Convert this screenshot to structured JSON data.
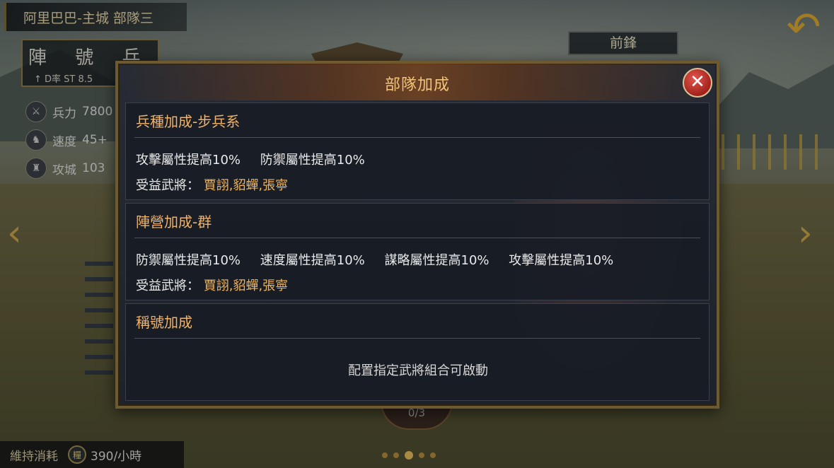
{
  "header": {
    "city_title": "阿里巴巴-主城 部隊三",
    "formation_badge": "陣 號 兵",
    "formation_sub": "↑ D率 ST  8.5",
    "vanguard_label": "前鋒"
  },
  "side_stats": [
    {
      "icon": "soldier-icon",
      "label": "兵力",
      "value": "7800"
    },
    {
      "icon": "horse-icon",
      "label": "速度",
      "value": "45+"
    },
    {
      "icon": "castle-icon",
      "label": "攻城",
      "value": "103"
    }
  ],
  "footer": {
    "upkeep_label": "維持消耗",
    "upkeep_value": "390/小時",
    "counter": "0/3",
    "page_dots": 5,
    "active_dot": 2
  },
  "modal": {
    "title": "部隊加成",
    "close_label": "✕",
    "sections": [
      {
        "title": "兵種加成-步兵系",
        "effects": [
          "攻擊屬性提高10%",
          "防禦屬性提高10%"
        ],
        "beneficiary_label": "受益武將：",
        "beneficiaries": "賈詡,貂蟬,張寧"
      },
      {
        "title": "陣營加成-群",
        "effects": [
          "防禦屬性提高10%",
          "速度屬性提高10%",
          "謀略屬性提高10%",
          "攻擊屬性提高10%"
        ],
        "beneficiary_label": "受益武將：",
        "beneficiaries": "賈詡,貂蟬,張寧"
      },
      {
        "title": "稱號加成",
        "note": "配置指定武將組合可啟動"
      }
    ]
  },
  "colors": {
    "accent_gold": "#efb36a",
    "close_red": "#c0392b",
    "panel_bg": "#1e222b"
  }
}
